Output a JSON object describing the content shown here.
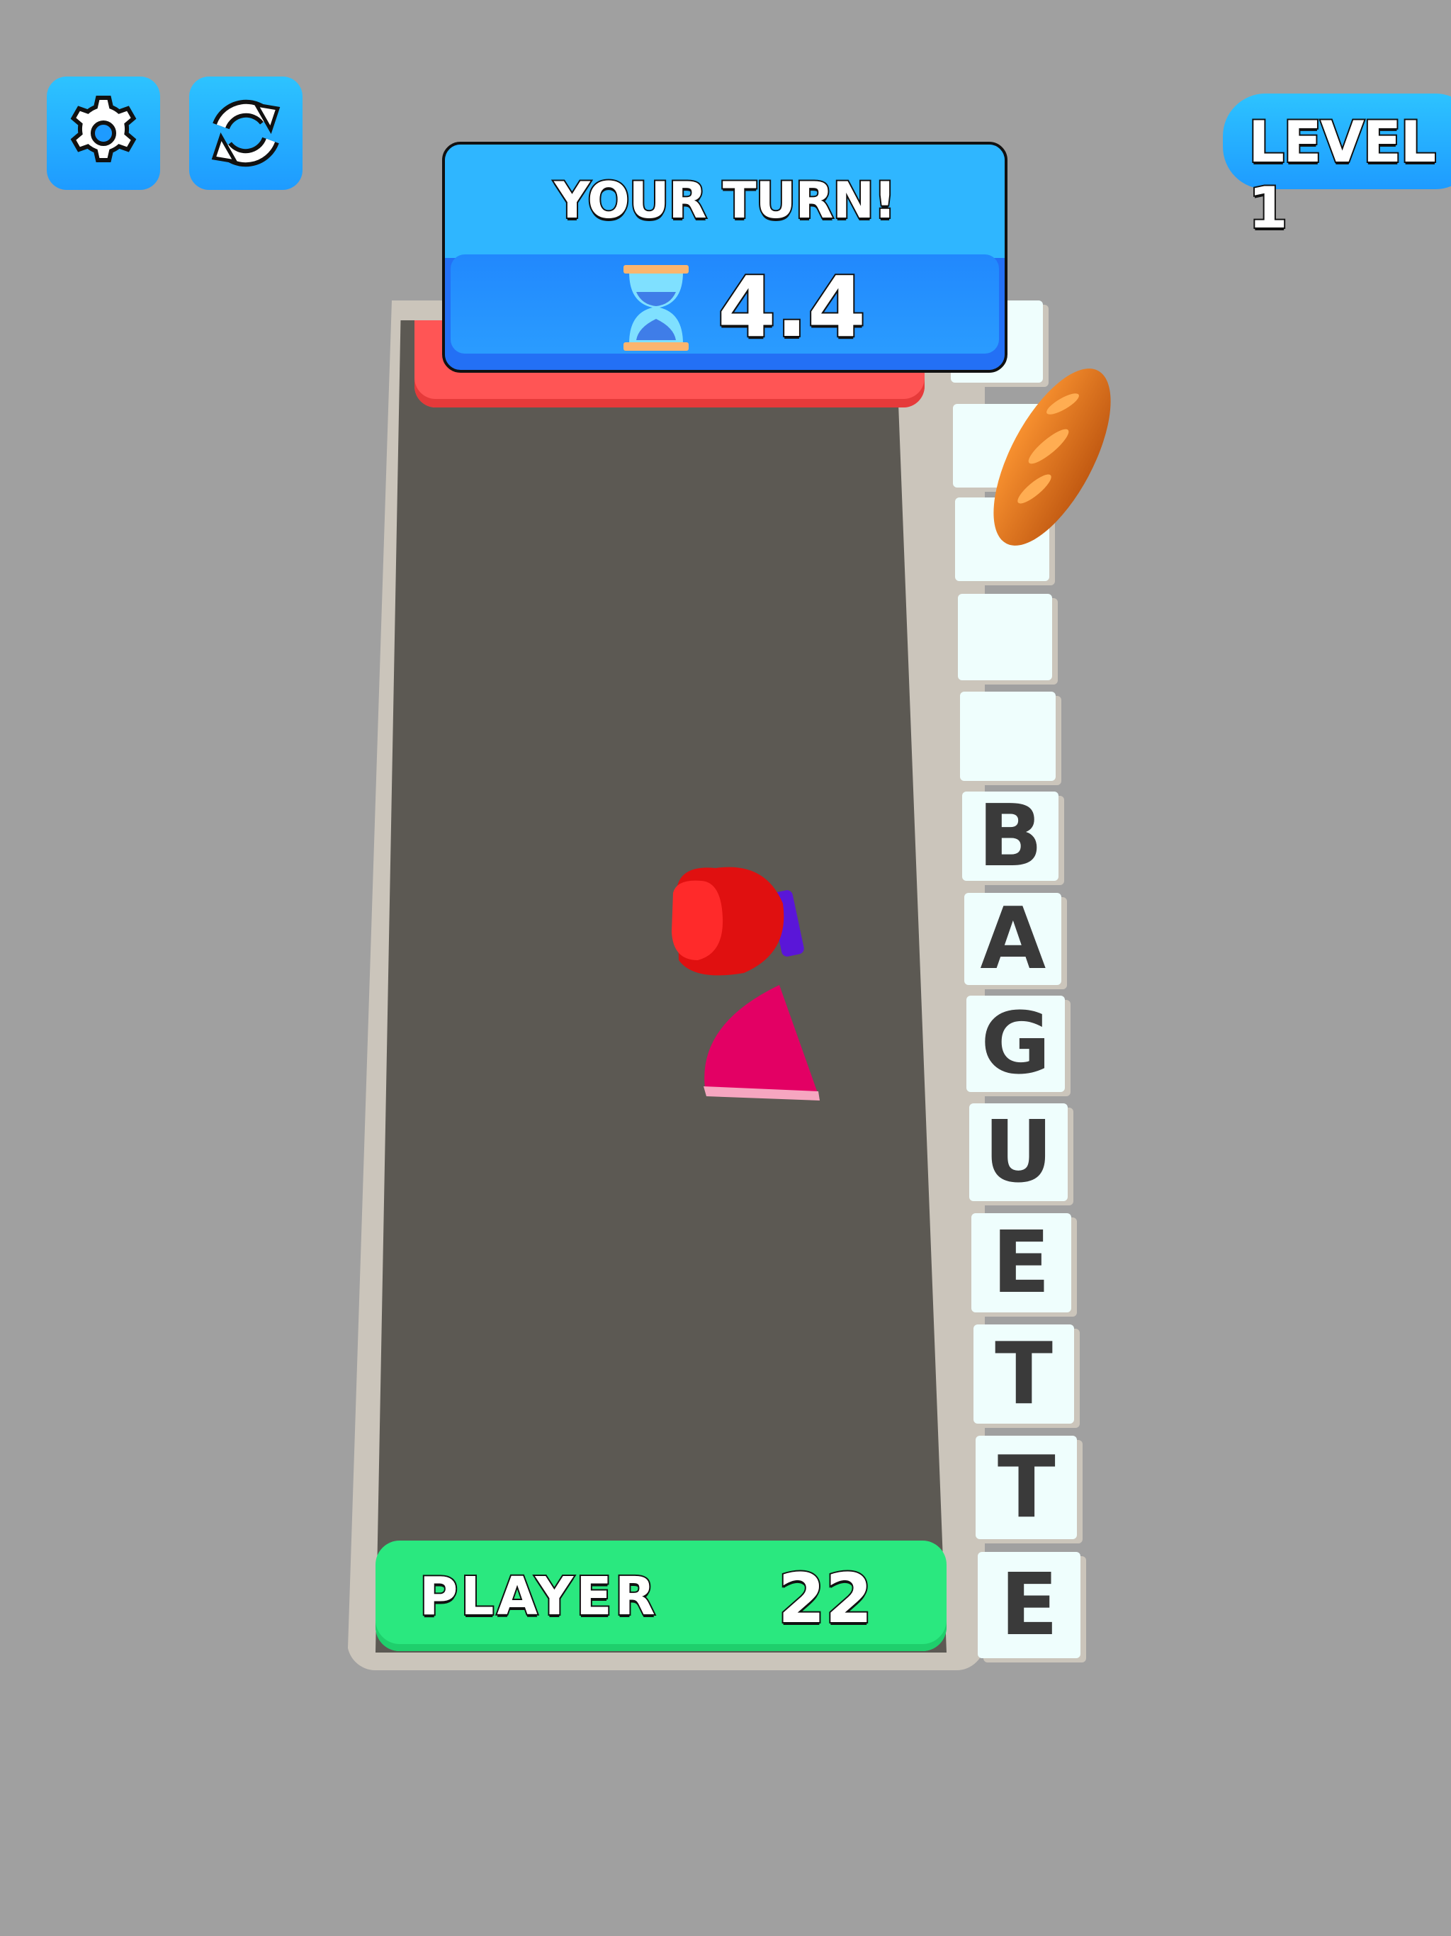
{
  "toolbar": {
    "settings_icon": "gear-icon",
    "restart_icon": "refresh-icon"
  },
  "level": {
    "label": "LEVEL 1"
  },
  "turn_panel": {
    "title": "YOUR TURN!",
    "timer_icon": "hourglass-icon",
    "timer_value": "4.4"
  },
  "opponent_bar": {
    "color": "#ff5555"
  },
  "player_bar": {
    "name": "PLAYER",
    "score": "22",
    "color": "#2ae87f"
  },
  "word_tiles": [
    "",
    "",
    "",
    "",
    "",
    "B",
    "A",
    "G",
    "U",
    "E",
    "T",
    "T",
    "E"
  ],
  "objects": [
    "baguette",
    "boxing-glove",
    "pink-wedge"
  ]
}
